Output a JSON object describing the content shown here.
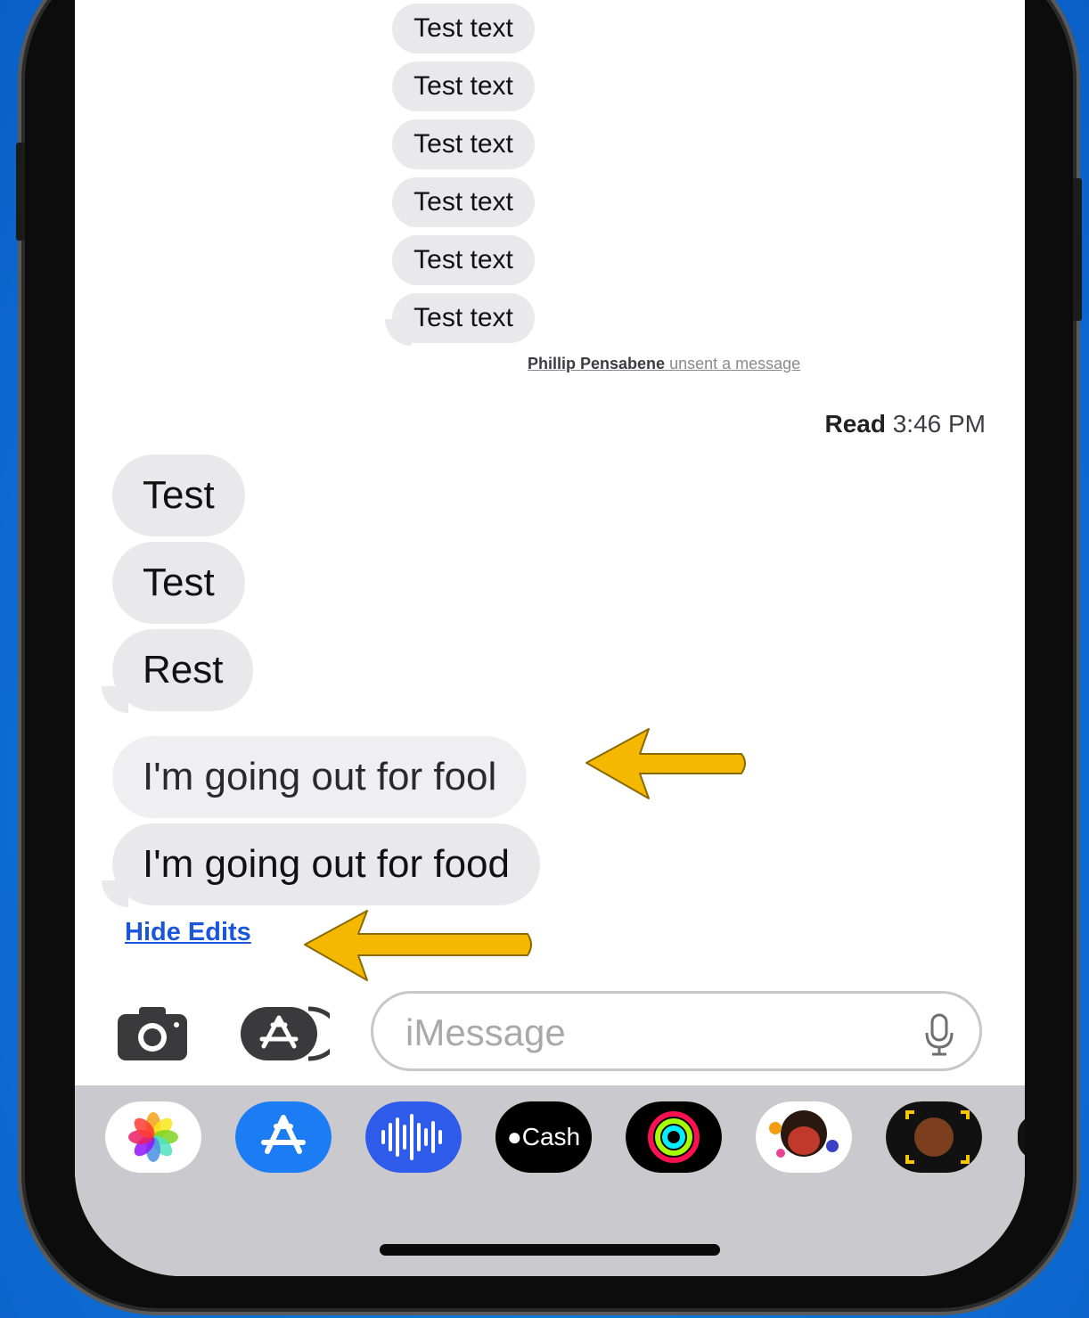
{
  "thread": {
    "old_messages": [
      "Test text",
      "Test text",
      "Test text",
      "Test text",
      "Test text",
      "Test text"
    ],
    "unsent_notice": {
      "name": "Phillip Pensabene",
      "action": "unsent a message"
    },
    "read_receipt": {
      "label": "Read",
      "time": "3:46 PM"
    },
    "recent_messages": [
      "Test",
      "Test",
      "Rest"
    ],
    "edit_history": {
      "original": "I'm going out for fool",
      "edited": "I'm going out for food"
    },
    "hide_edits_label": "Hide Edits"
  },
  "composer": {
    "placeholder": "iMessage"
  },
  "app_tray": {
    "cash_label": "Cash",
    "items": [
      "photos-app-icon",
      "app-store-icon",
      "audio-message-icon",
      "apple-cash-icon",
      "activity-icon",
      "memoji-stickers-icon",
      "memoji-icon"
    ]
  },
  "colors": {
    "background": "#0d6fd8",
    "bubble": "#e9e9eb",
    "link": "#1a56db",
    "arrow": "#f5b800",
    "tray": "#c9c9ce"
  }
}
